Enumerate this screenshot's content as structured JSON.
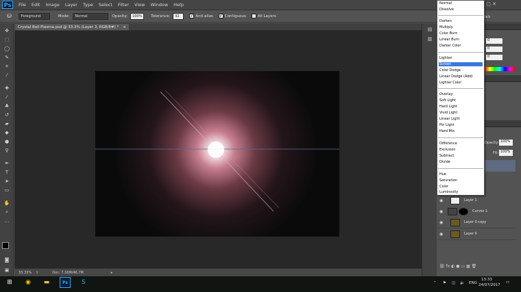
{
  "app": {
    "logo": "Ps"
  },
  "menu": [
    "File",
    "Edit",
    "Image",
    "Layer",
    "Type",
    "Select",
    "Filter",
    "View",
    "Window",
    "Help"
  ],
  "options_bar": {
    "source": "Foreground",
    "mode_label": "Mode:",
    "mode_value": "Normal",
    "opacity_label": "Opacity:",
    "opacity_value": "100%",
    "tolerance_label": "Tolerance:",
    "tolerance_value": "32",
    "antialias_label": "Anti-alias",
    "contiguous_label": "Contiguous",
    "alllayers_label": "All Layers"
  },
  "document": {
    "tab_title": "Crystal Ball Plasma.psd @ 33.3% (Layer 3, RGB/8#) *",
    "close": "×"
  },
  "status": {
    "zoom": "33.33%",
    "doc": "Doc: 7.16M/46.7M"
  },
  "blend_modes": {
    "groups": [
      [
        "Normal",
        "Dissolve"
      ],
      [
        "Darken",
        "Multiply",
        "Color Burn",
        "Linear Burn",
        "Darker Color"
      ],
      [
        "Lighten",
        "Screen",
        "Color Dodge",
        "Linear Dodge (Add)",
        "Lighter Color"
      ],
      [
        "Overlay",
        "Soft Light",
        "Hard Light",
        "Vivid Light",
        "Linear Light",
        "Pin Light",
        "Hard Mix"
      ],
      [
        "Difference",
        "Exclusion",
        "Subtract",
        "Divide"
      ],
      [
        "Hue",
        "Saturation",
        "Color",
        "Luminosity"
      ]
    ],
    "selected": "Screen"
  },
  "color_panel": {
    "val1": "0",
    "val2": "0",
    "val3": "0",
    "lbl": "ials"
  },
  "layers_panel": {
    "opacity_label": "Opacity:",
    "opacity_value": "100%",
    "fill_label": "Fill:",
    "fill_value": "100%",
    "layers": [
      {
        "name": "Layer 1"
      },
      {
        "name": "Curves 1"
      },
      {
        "name": "Layer 0 copy"
      },
      {
        "name": "Layer 0"
      }
    ]
  },
  "taskbar": {
    "lang": "ENG",
    "time": "13:33",
    "date": "24/07/2017"
  },
  "colors": {
    "accent": "#3c78d8",
    "flare": "#c87f90"
  }
}
